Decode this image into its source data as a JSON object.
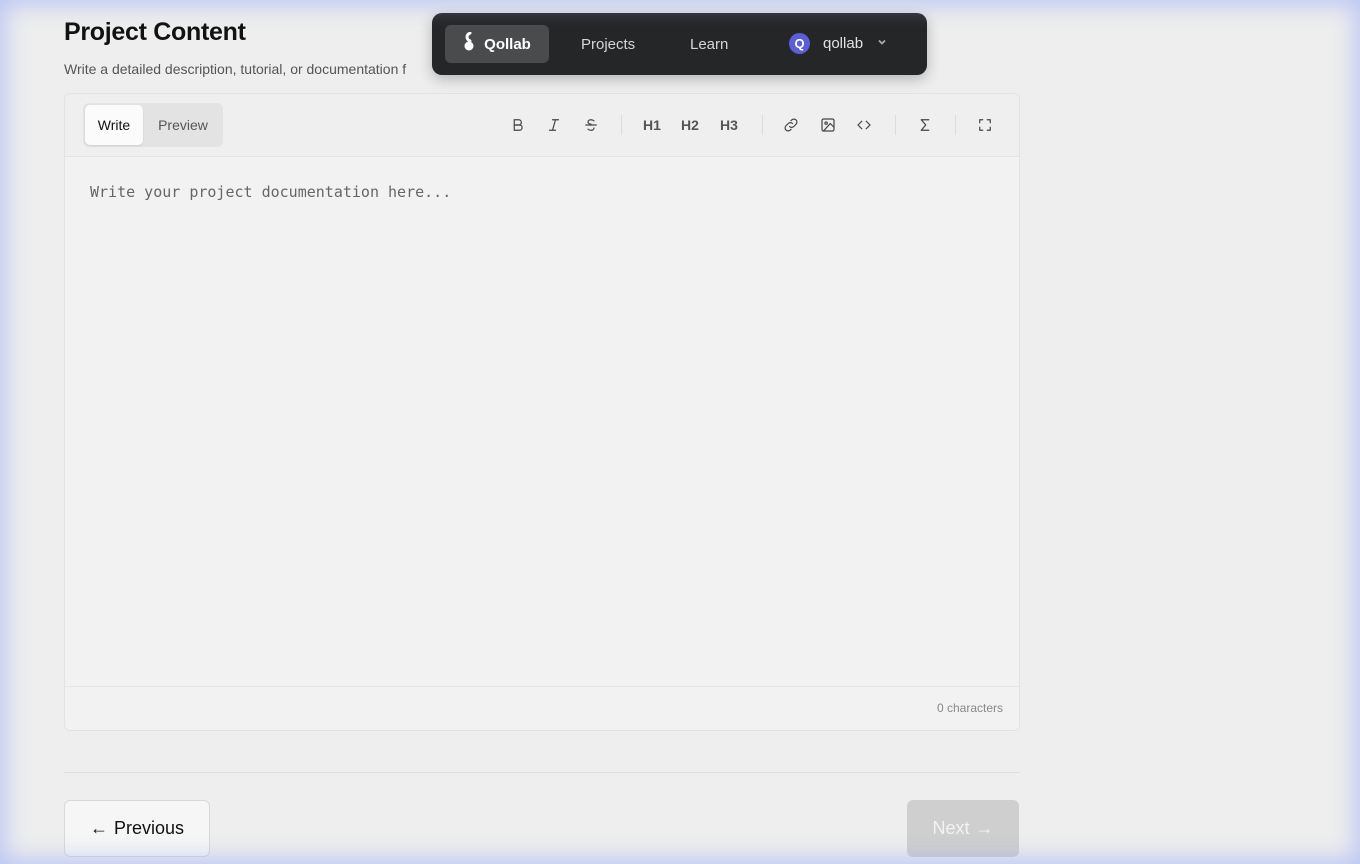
{
  "header": {
    "title": "Project Content",
    "subtitle": "Write a detailed description, tutorial, or documentation f"
  },
  "navbar": {
    "brand": "Qollab",
    "links": [
      "Projects",
      "Learn"
    ],
    "user": {
      "avatar_letter": "Q",
      "name": "qollab",
      "avatar_color": "#5b5fd6"
    }
  },
  "editor": {
    "modes": {
      "write": "Write",
      "preview": "Preview",
      "active": "Write"
    },
    "toolbar": {
      "bold_icon": "bold-icon",
      "italic_icon": "italic-icon",
      "strikethrough_icon": "strikethrough-icon",
      "h1": "H1",
      "h2": "H2",
      "h3": "H3",
      "link_icon": "link-icon",
      "image_icon": "image-icon",
      "code_icon": "code-icon",
      "math_icon": "sigma-icon",
      "fullscreen_icon": "fullscreen-icon"
    },
    "placeholder": "Write your project documentation here...",
    "value": "",
    "char_count": "0 characters"
  },
  "footer": {
    "previous_label": "Previous",
    "next_label": "Next",
    "previous_arrow": "←",
    "next_arrow": "→"
  }
}
